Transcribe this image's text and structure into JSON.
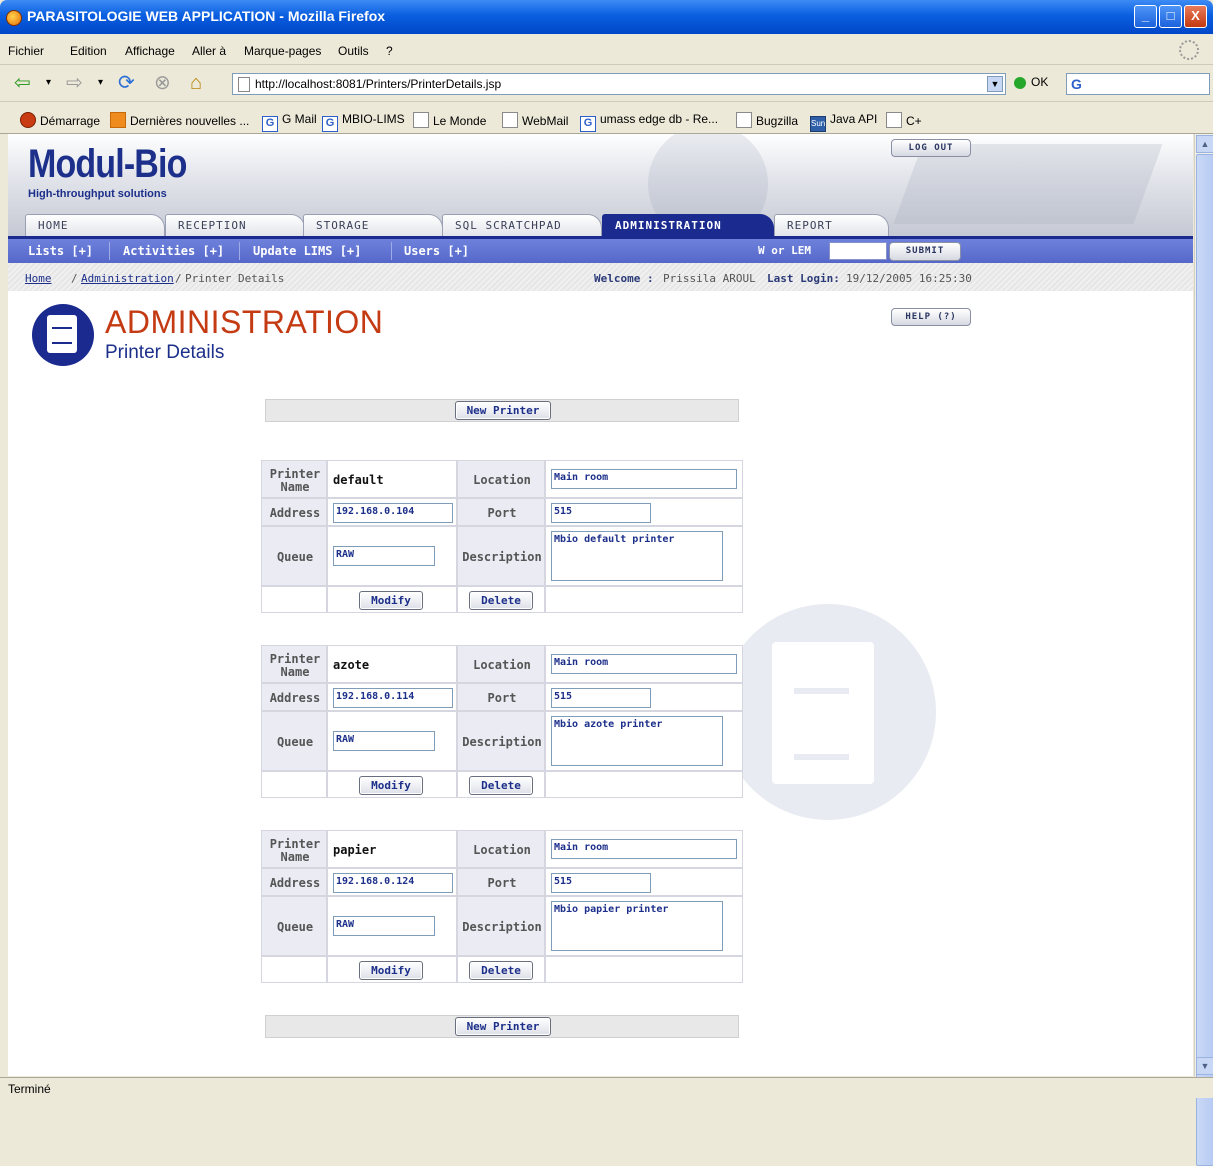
{
  "window": {
    "title": "PARASITOLOGIE WEB APPLICATION - Mozilla Firefox",
    "minimize": "_",
    "maximize": "□",
    "close": "X"
  },
  "menu": [
    "Fichier",
    "Edition",
    "Affichage",
    "Aller à",
    "Marque-pages",
    "Outils",
    "?"
  ],
  "toolbar": {
    "url": "http://localhost:8081/Printers/PrinterDetails.jsp",
    "go_label": "OK",
    "search_placeholder": ""
  },
  "bookmarks": [
    {
      "label": "Démarrage",
      "icon": "firefox-icon"
    },
    {
      "label": "Dernières nouvelles ...",
      "icon": "rss-icon"
    },
    {
      "label": "G Mail",
      "icon": "google-icon"
    },
    {
      "label": "MBIO-LIMS",
      "icon": "google-icon"
    },
    {
      "label": "Le Monde",
      "icon": "page-icon"
    },
    {
      "label": "WebMail",
      "icon": "page-icon"
    },
    {
      "label": "umass edge db - Re...",
      "icon": "google-icon"
    },
    {
      "label": "Bugzilla",
      "icon": "page-icon"
    },
    {
      "label": "Java API",
      "icon": "sun-icon"
    },
    {
      "label": "C+",
      "icon": "page-icon"
    }
  ],
  "status": "Terminé",
  "app": {
    "logo": "Modul-Bio",
    "tagline": "High-throughput solutions",
    "logout": "LOG OUT",
    "help": "HELP (?)",
    "tabs": [
      "HOME",
      "RECEPTION",
      "STORAGE",
      "SQL SCRATCHPAD",
      "ADMINISTRATION",
      "REPORT"
    ],
    "active_tab": "ADMINISTRATION",
    "subnav": [
      "Lists [+]",
      "Activities [+]",
      "Update LIMS [+]",
      "Users [+]"
    ],
    "w_or_lem_label": "W or LEM",
    "submit": "SUBMIT",
    "breadcrumb": {
      "home": "Home",
      "admin": "Administration",
      "sep": "/",
      "current": "Printer Details"
    },
    "welcome_label": "Welcome :",
    "welcome_user": "Prissila AROUL",
    "last_login_label": "Last Login:",
    "last_login": "19/12/2005 16:25:30",
    "page_title": "ADMINISTRATION",
    "page_subtitle": "Printer Details",
    "new_printer": "New Printer"
  },
  "labels": {
    "printer_name": "Printer Name",
    "address": "Address",
    "queue": "Queue",
    "location": "Location",
    "port": "Port",
    "description": "Description",
    "modify": "Modify",
    "delete": "Delete"
  },
  "printers": [
    {
      "name": "default",
      "address": "192.168.0.104",
      "queue": "RAW",
      "location": "Main room",
      "port": "515",
      "description": "Mbio default printer"
    },
    {
      "name": "azote",
      "address": "192.168.0.114",
      "queue": "RAW",
      "location": "Main room",
      "port": "515",
      "description": "Mbio azote printer"
    },
    {
      "name": "papier",
      "address": "192.168.0.124",
      "queue": "RAW",
      "location": "Main room",
      "port": "515",
      "description": "Mbio papier printer"
    }
  ]
}
